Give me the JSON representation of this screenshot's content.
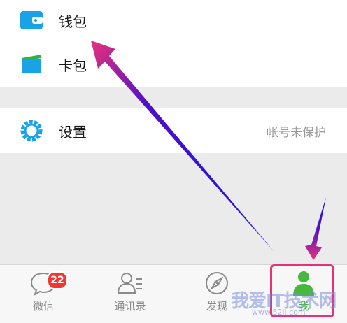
{
  "wallet": {
    "label": "钱包",
    "icon": "wallet-icon"
  },
  "card": {
    "label": "卡包",
    "icon": "card-icon"
  },
  "settings": {
    "label": "设置",
    "value": "帐号未保护",
    "icon": "gear-icon"
  },
  "tabs": [
    {
      "label": "微信",
      "badge": "22",
      "icon": "chat-bubble-icon"
    },
    {
      "label": "通讯录",
      "icon": "contacts-icon"
    },
    {
      "label": "发现",
      "icon": "compass-icon"
    },
    {
      "label": "我",
      "icon": "person-icon"
    }
  ],
  "watermark": {
    "text": "我爱IT技术网",
    "sub": "www.52ij.com"
  },
  "colors": {
    "accent_blue": "#1aa2e6",
    "green": "#46b83b",
    "highlight": "#e7327a",
    "badge": "#f43530"
  }
}
